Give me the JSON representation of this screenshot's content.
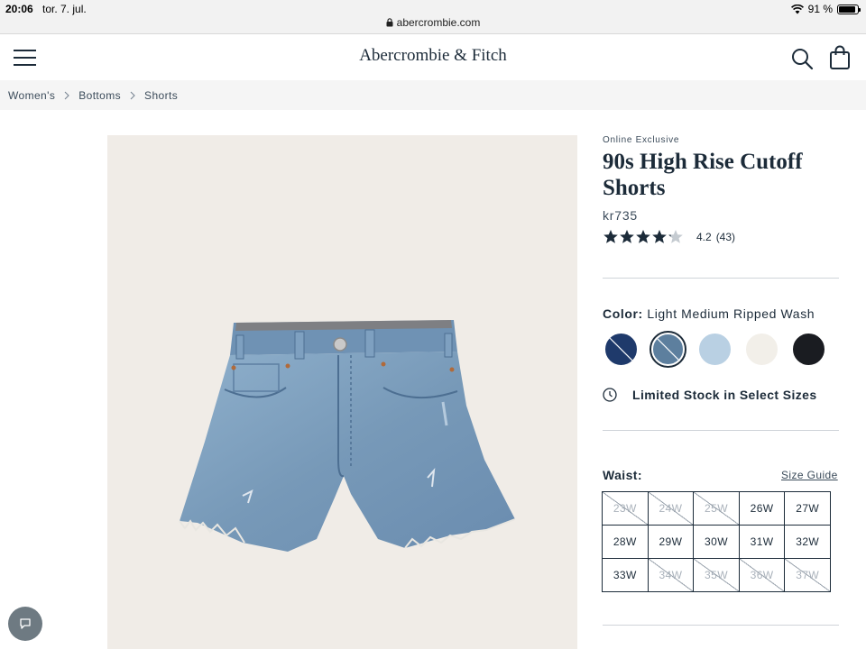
{
  "status_bar": {
    "time": "20:06",
    "date": "tor. 7. jul.",
    "url": "abercrombie.com",
    "battery": "91 %",
    "battery_level": 0.91
  },
  "header": {
    "brand": "Abercrombie & Fitch",
    "menu_icon": "hamburger-menu-icon",
    "search_icon": "search-icon",
    "bag_icon": "shopping-bag-icon"
  },
  "breadcrumb": [
    "Women's",
    "Bottoms",
    "Shorts"
  ],
  "product": {
    "badge": "Online Exclusive",
    "title": "90s High Rise Cutoff Shorts",
    "price": "kr735",
    "rating": "4.2",
    "rating_value": 4.2,
    "review_count": "(43)",
    "color_label": "Color:",
    "color_name": "Light Medium Ripped Wash",
    "swatches": [
      {
        "color": "#1f3a6b",
        "selected": false,
        "crossed": true
      },
      {
        "color": "#5d7f9e",
        "selected": true,
        "crossed": true
      },
      {
        "color": "#b9d0e3",
        "selected": false,
        "crossed": false
      },
      {
        "color": "#f2efe9",
        "selected": false,
        "crossed": false
      },
      {
        "color": "#1a1c21",
        "selected": false,
        "crossed": false
      }
    ],
    "stock_message": "Limited Stock in Select Sizes",
    "waist_label": "Waist:",
    "size_guide": "Size Guide",
    "sizes": [
      {
        "label": "23W",
        "available": false
      },
      {
        "label": "24W",
        "available": false
      },
      {
        "label": "25W",
        "available": false
      },
      {
        "label": "26W",
        "available": true
      },
      {
        "label": "27W",
        "available": true
      },
      {
        "label": "28W",
        "available": true
      },
      {
        "label": "29W",
        "available": true
      },
      {
        "label": "30W",
        "available": true
      },
      {
        "label": "31W",
        "available": true
      },
      {
        "label": "32W",
        "available": true
      },
      {
        "label": "33W",
        "available": true
      },
      {
        "label": "34W",
        "available": false
      },
      {
        "label": "35W",
        "available": false
      },
      {
        "label": "36W",
        "available": false
      },
      {
        "label": "37W",
        "available": false
      }
    ]
  },
  "colors": {
    "navy": "#1c2b39",
    "breadcrumb_bg": "#f5f5f5",
    "image_bg": "#f0ece7",
    "denim": "#7e9fbe"
  },
  "chat_icon": "chat-bubble-icon"
}
